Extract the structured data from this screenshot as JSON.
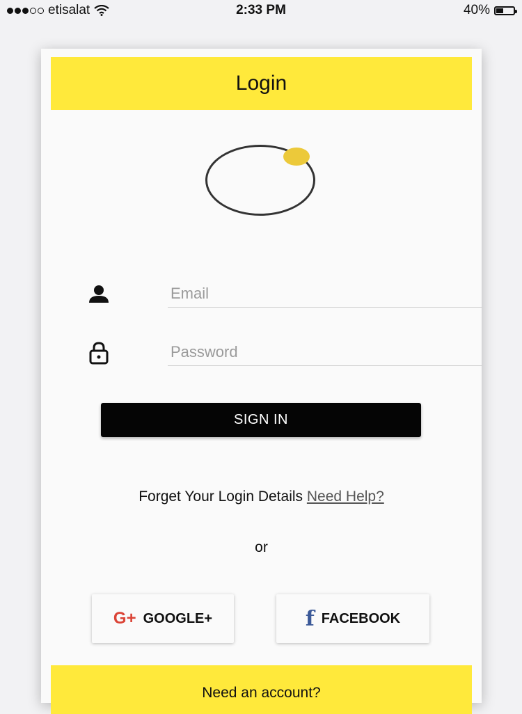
{
  "status_bar": {
    "carrier": "etisalat",
    "time": "2:33 PM",
    "battery_text": "40%",
    "battery_level": 0.4
  },
  "login": {
    "title": "Login",
    "email_placeholder": "Email",
    "password_placeholder": "Password",
    "sign_in_label": "SIGN IN",
    "help_text": "Forget Your Login Details",
    "help_link": "Need Help?",
    "or_text": "or",
    "google_label": "GOOGLE+",
    "google_icon_text": "G+",
    "facebook_label": "FACEBOOK",
    "facebook_icon_text": "f",
    "footer_text": "Need an account?"
  },
  "colors": {
    "accent": "#ffe93b",
    "logo_dot": "#ecc93a",
    "google": "#db4437",
    "facebook": "#3b5998"
  },
  "icons": {
    "wifi": "wifi-icon",
    "user": "user-icon",
    "lock": "lock-icon",
    "google": "google-plus-icon",
    "facebook": "facebook-icon"
  }
}
